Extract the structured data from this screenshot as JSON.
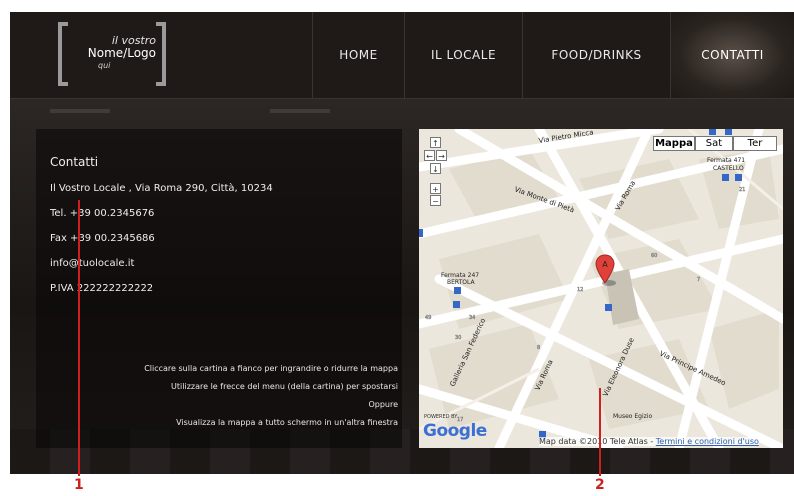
{
  "logo": {
    "line1": "il vostro",
    "line2": "Nome/Logo",
    "line3": "qui"
  },
  "nav": [
    {
      "label": "HOME",
      "active": false
    },
    {
      "label": "IL LOCALE",
      "active": false
    },
    {
      "label": "FOOD/DRINKS",
      "active": false
    },
    {
      "label": "CONTATTI",
      "active": true
    }
  ],
  "contact": {
    "title": "Contatti",
    "address": "Il Vostro Locale , Via Roma 290, Città, 10234",
    "phone": "Tel. +39 00.2345676",
    "fax": "Fax +39 00.2345686",
    "email": "info@tuolocale.it",
    "vat": "P.IVA 222222222222"
  },
  "map_hints": [
    "Cliccare sulla cartina a fianco per ingrandire o ridurre la mappa",
    "Utilizzare le frecce del menu (della cartina) per spostarsi",
    "Oppure",
    "Visualizza la mappa a tutto schermo in un'altra finestra"
  ],
  "map": {
    "types": [
      "Mappa",
      "Sat",
      "Ter"
    ],
    "selected_type": "Mappa",
    "nav_controls": [
      "↑",
      "←",
      "→",
      "↓",
      "+",
      "−"
    ],
    "marker_label": "A",
    "streets": [
      "Via Pietro Micca",
      "Via Monte di Pietà",
      "Via Roma",
      "Galleria San Federico",
      "Via Roma",
      "Via Principe Amedeo",
      "Via Eleonora Duse"
    ],
    "stops": [
      "Fermata 471 CASTELLO",
      "Fermata 247 BERTOLA"
    ],
    "poi": "Museo Egizio",
    "powered_by": "POWERED BY",
    "brand": "Google",
    "attribution": "Map data ©2010 Tele Atlas - ",
    "terms_link": "Termini e condizioni d'uso"
  },
  "callouts": [
    "1",
    "2"
  ],
  "colors": {
    "callout": "#cf1f1f",
    "brand_blue": "#3b6fd4"
  }
}
